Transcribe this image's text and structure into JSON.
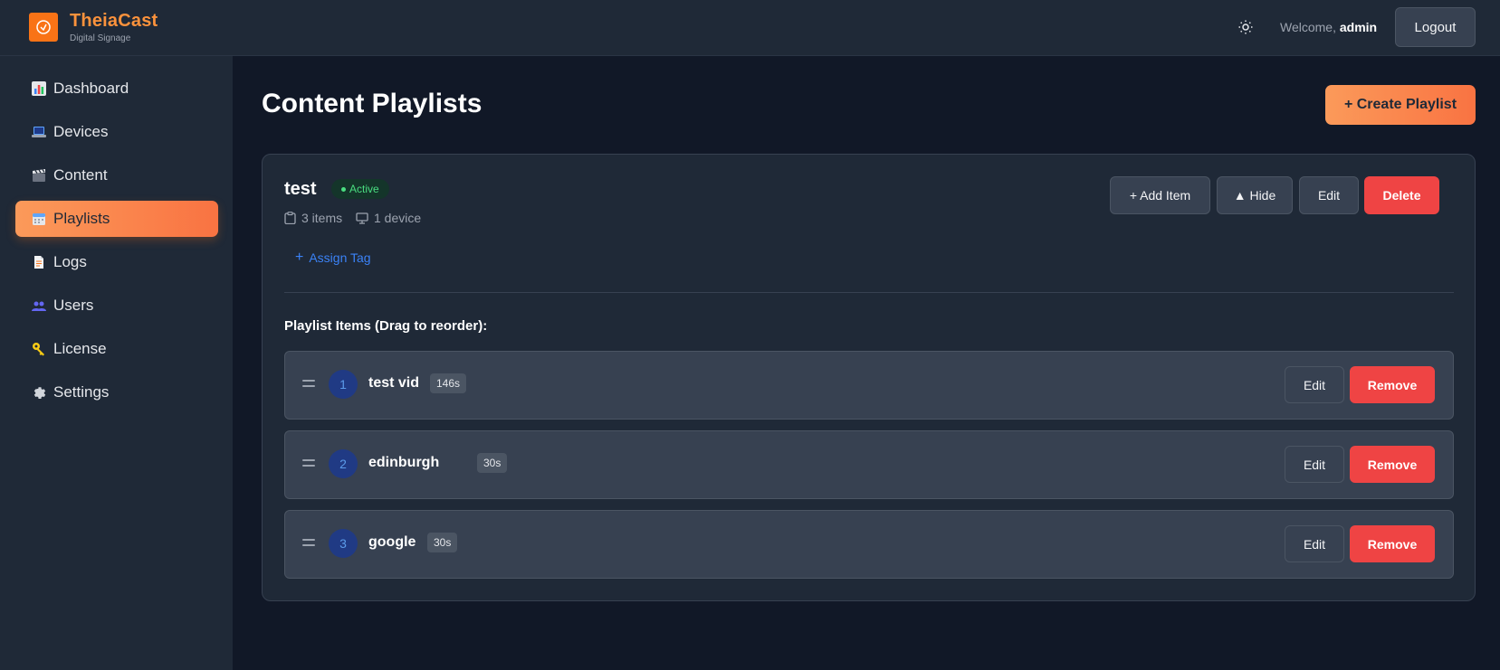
{
  "header": {
    "brand_title": "TheiaCast",
    "brand_subtitle": "Digital Signage",
    "welcome_prefix": "Welcome,",
    "username": "admin",
    "logout_label": "Logout",
    "theme_icon": "sun-icon"
  },
  "sidebar": {
    "items": [
      {
        "label": "Dashboard",
        "icon": "bar-chart-icon"
      },
      {
        "label": "Devices",
        "icon": "laptop-icon"
      },
      {
        "label": "Content",
        "icon": "clapperboard-icon"
      },
      {
        "label": "Playlists",
        "icon": "calendar-icon",
        "active": true
      },
      {
        "label": "Logs",
        "icon": "document-icon"
      },
      {
        "label": "Users",
        "icon": "users-icon"
      },
      {
        "label": "License",
        "icon": "key-icon"
      },
      {
        "label": "Settings",
        "icon": "gear-icon"
      }
    ]
  },
  "main": {
    "page_title": "Content Playlists",
    "create_label": "+ Create Playlist",
    "playlist": {
      "name": "test",
      "status": "Active",
      "item_count": "3 items",
      "device_count": "1 device",
      "assign_tag_label": "Assign Tag",
      "actions": {
        "add_item": "+ Add Item",
        "hide": "▲ Hide",
        "edit": "Edit",
        "delete": "Delete"
      },
      "items_heading": "Playlist Items (Drag to reorder):",
      "items": [
        {
          "index": "1",
          "name": "test vid",
          "duration": "146s"
        },
        {
          "index": "2",
          "name": "edinburgh",
          "duration": "30s"
        },
        {
          "index": "3",
          "name": "google",
          "duration": "30s"
        }
      ],
      "row_edit_label": "Edit",
      "row_remove_label": "Remove"
    }
  },
  "colors": {
    "accent": "#f97316",
    "danger": "#ef4444",
    "success": "#4ade80",
    "link": "#3b82f6"
  }
}
